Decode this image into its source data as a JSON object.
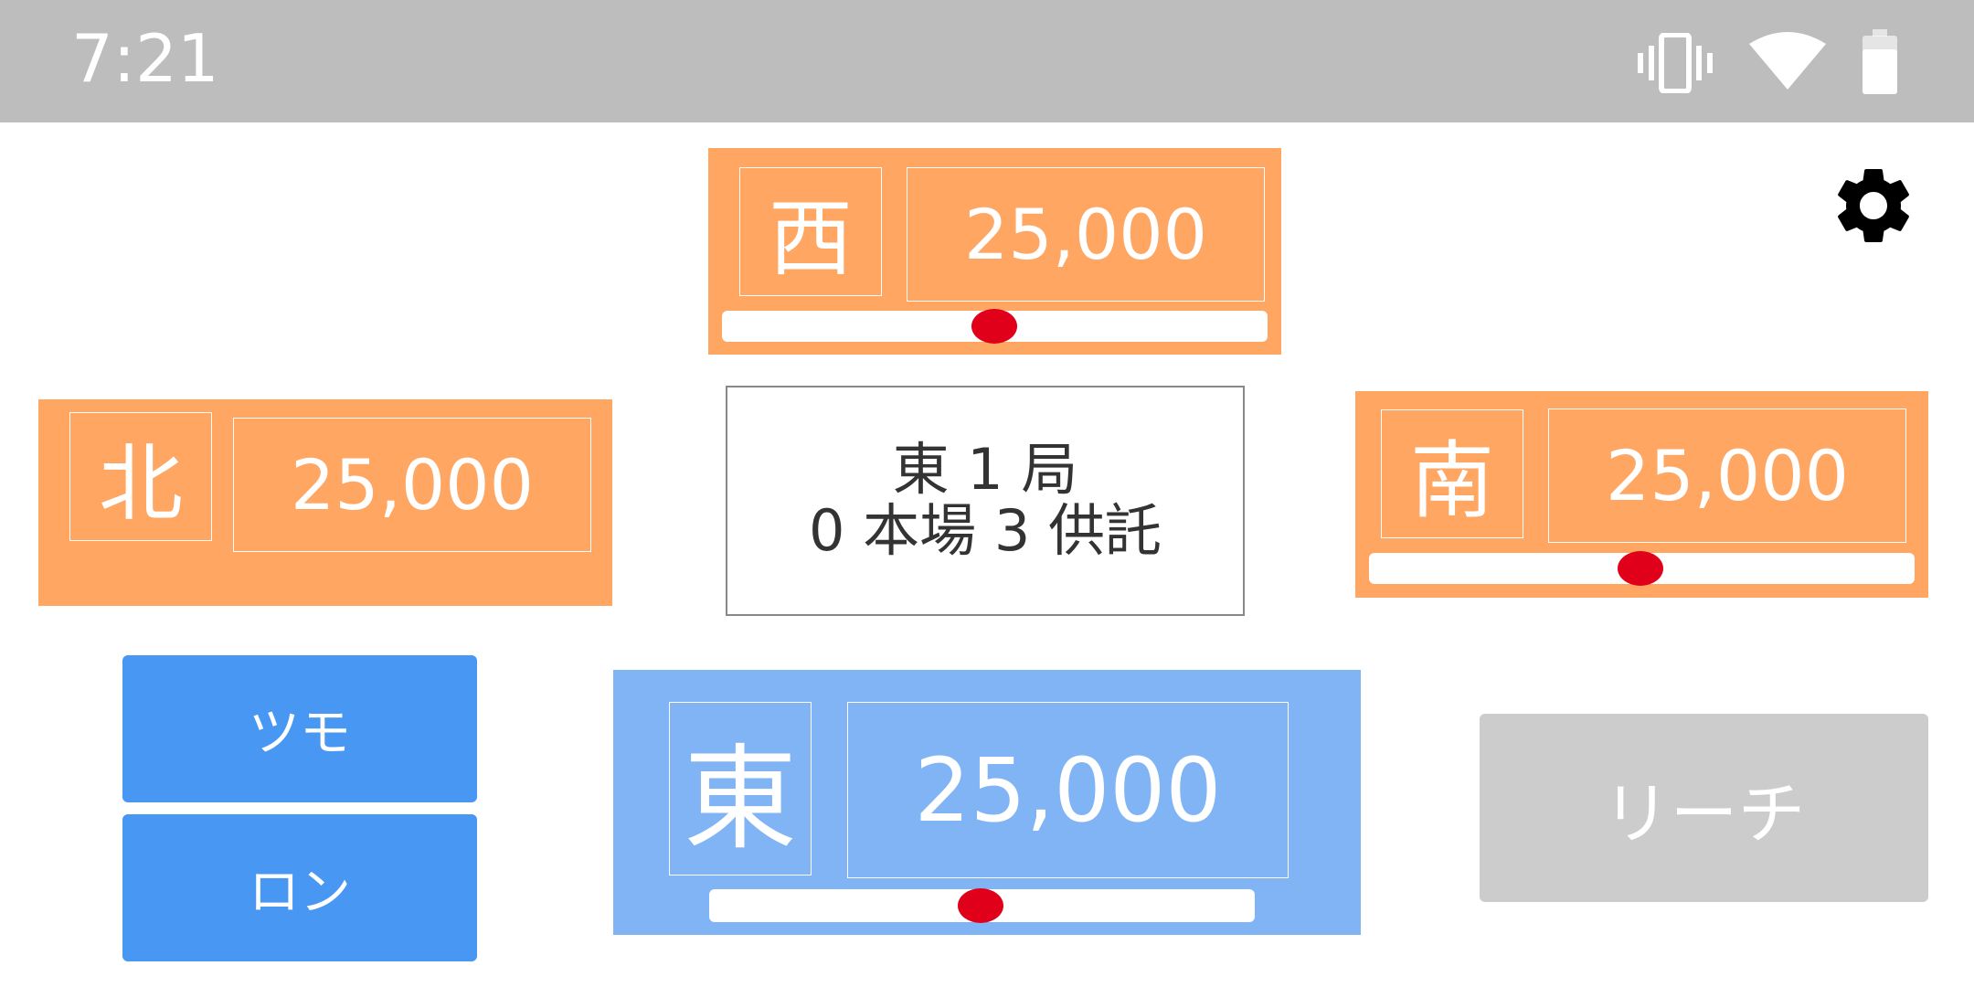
{
  "status_bar": {
    "time": "7:21",
    "icons": [
      "vibrate-icon",
      "wifi-icon",
      "battery-icon"
    ]
  },
  "settings": {
    "icon": "gear-icon"
  },
  "players": {
    "west": {
      "wind": "西",
      "score": "25,000",
      "color": "#ffa662",
      "slider_level": 0.5
    },
    "north": {
      "wind": "北",
      "score": "25,000",
      "color": "#ffa662"
    },
    "south": {
      "wind": "南",
      "score": "25,000",
      "color": "#ffa662",
      "slider_level": 0.5
    },
    "east": {
      "wind": "東",
      "score": "25,000",
      "color": "#80b4f5",
      "slider_level": 0.5
    }
  },
  "round": {
    "line1": "東 1 局",
    "line2": "0 本場 3 供託"
  },
  "actions": {
    "tsumo": "ツモ",
    "ron": "ロン",
    "riichi": "リーチ"
  },
  "colors": {
    "accent_orange": "#ffa662",
    "accent_blue": "#80b4f5",
    "button_blue": "#4797f3",
    "slider_dot": "#e00019",
    "disabled_gray": "#cccccc"
  }
}
